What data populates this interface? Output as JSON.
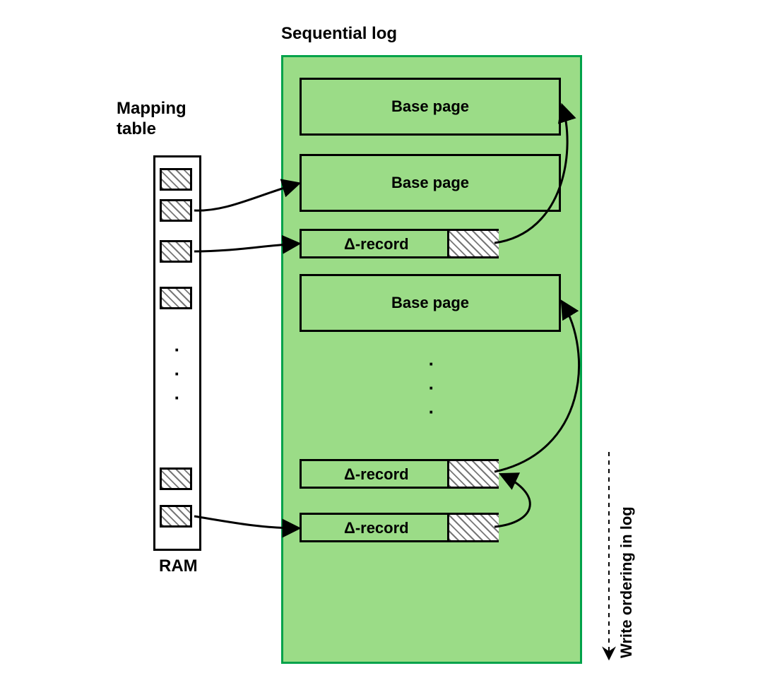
{
  "title_sequential_log": "Sequential log",
  "title_mapping_table": "Mapping\ntable",
  "ram_label": "RAM",
  "write_ordering_label": "Write ordering  in log",
  "log_items": {
    "base_page_1": "Base page",
    "base_page_2": "Base page",
    "delta_record_1": "Δ-record",
    "base_page_3": "Base page",
    "delta_record_2": "Δ-record",
    "delta_record_3": "Δ-record"
  }
}
